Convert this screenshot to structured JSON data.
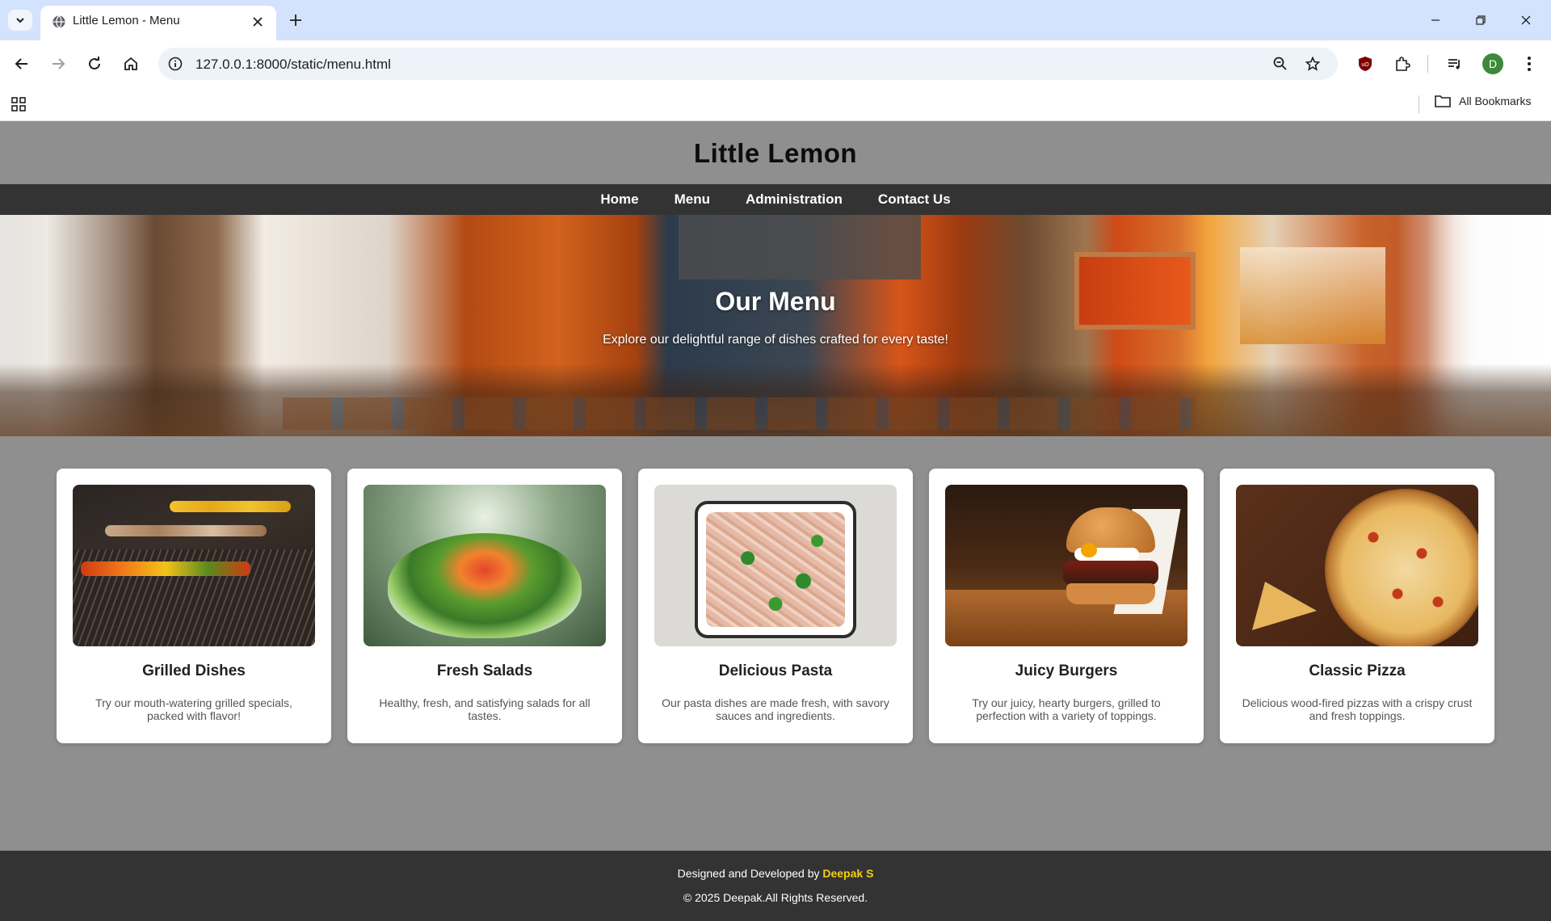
{
  "browser": {
    "tab_title": "Little Lemon - Menu",
    "url": "127.0.0.1:8000/static/menu.html",
    "profile_initial": "D",
    "bookmarks_label": "All Bookmarks"
  },
  "site": {
    "title": "Little Lemon",
    "nav": [
      "Home",
      "Menu",
      "Administration",
      "Contact Us"
    ]
  },
  "hero": {
    "title": "Our Menu",
    "subtitle": "Explore our delightful range of dishes crafted for every taste!"
  },
  "cards": [
    {
      "title": "Grilled Dishes",
      "desc": "Try our mouth-watering grilled specials, packed with flavor!"
    },
    {
      "title": "Fresh Salads",
      "desc": "Healthy, fresh, and satisfying salads for all tastes."
    },
    {
      "title": "Delicious Pasta",
      "desc": "Our pasta dishes are made fresh, with savory sauces and ingredients."
    },
    {
      "title": "Juicy Burgers",
      "desc": "Try our juicy, hearty burgers, grilled to perfection with a variety of toppings."
    },
    {
      "title": "Classic Pizza",
      "desc": "Delicious wood-fired pizzas with a crispy crust and fresh toppings."
    }
  ],
  "footer": {
    "designed_by": "Designed and Developed by",
    "author": "Deepak S",
    "copyright": "© 2025 Deepak.All Rights Reserved."
  },
  "colors": {
    "page_bg": "#8f8f8f",
    "nav_bg": "#333333",
    "accent_author": "#f4ce14"
  }
}
